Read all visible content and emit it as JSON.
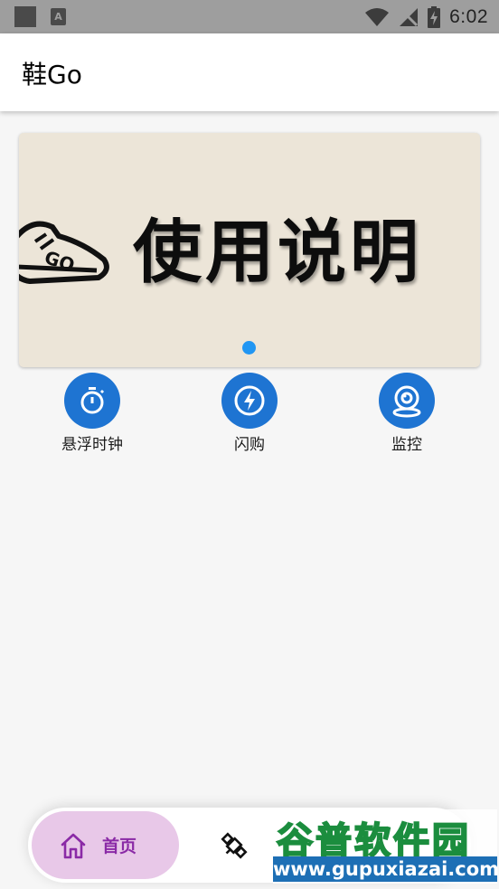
{
  "status_bar": {
    "time": "6:02",
    "notification_icon": "a-letter-icon",
    "icons": [
      "wifi-icon",
      "no-signal-icon",
      "battery-charging-icon"
    ]
  },
  "app_bar": {
    "title": "鞋Go"
  },
  "banner": {
    "text": "使用说明",
    "logo_text": "GO",
    "indicator_color": "#2196f3"
  },
  "features": [
    {
      "label": "悬浮时钟",
      "icon": "stopwatch-icon"
    },
    {
      "label": "闪购",
      "icon": "lightning-icon"
    },
    {
      "label": "监控",
      "icon": "webcam-icon"
    }
  ],
  "bottom_nav": {
    "items": [
      {
        "label": "首页",
        "icon": "home-icon",
        "selected": true
      },
      {
        "label": "",
        "icon": "satellite-icon",
        "selected": false
      }
    ]
  },
  "watermark": {
    "title": "谷普软件园",
    "url": "www.gupuxiazai.com"
  },
  "colors": {
    "accent": "#1e74d2",
    "nav_selected_bg": "#e8c8e8",
    "nav_selected_text": "#8a2aa6",
    "banner_bg": "#ece5d8"
  }
}
